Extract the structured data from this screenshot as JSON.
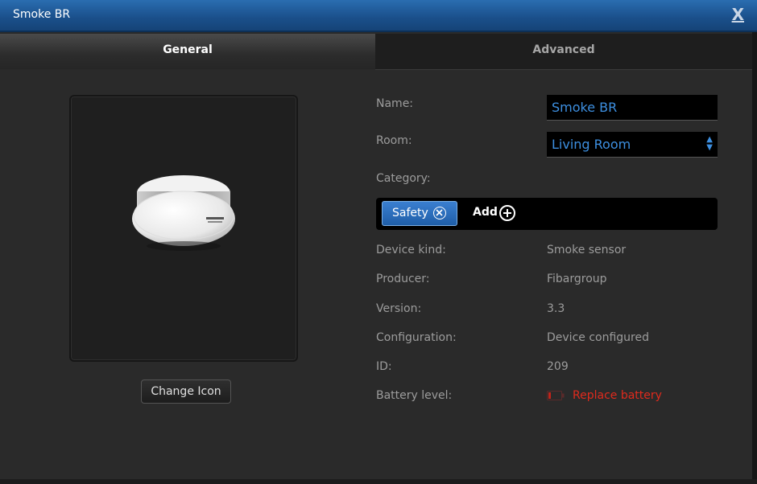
{
  "window": {
    "title": "Smoke BR",
    "close_label": "X"
  },
  "tabs": [
    {
      "label": "General",
      "active": true
    },
    {
      "label": "Advanced",
      "active": false
    }
  ],
  "device_image": {
    "icon_name": "smoke-detector-icon",
    "change_icon_label": "Change Icon"
  },
  "form": {
    "name_label": "Name:",
    "name_value": "Smoke BR",
    "room_label": "Room:",
    "room_value": "Living Room",
    "category_label": "Category:",
    "category_chip": "Safety",
    "category_add_label": "Add"
  },
  "details": [
    {
      "label": "Device kind:",
      "value": "Smoke sensor"
    },
    {
      "label": "Producer:",
      "value": "Fibargroup"
    },
    {
      "label": "Version:",
      "value": "3.3"
    },
    {
      "label": "Configuration:",
      "value": "Device configured"
    },
    {
      "label": "ID:",
      "value": "209"
    }
  ],
  "battery": {
    "label": "Battery level:",
    "status": "Replace battery",
    "status_color": "#e02a1d"
  },
  "colors": {
    "accent": "#3d8fe0",
    "titlebar": "#1a4f8a"
  }
}
